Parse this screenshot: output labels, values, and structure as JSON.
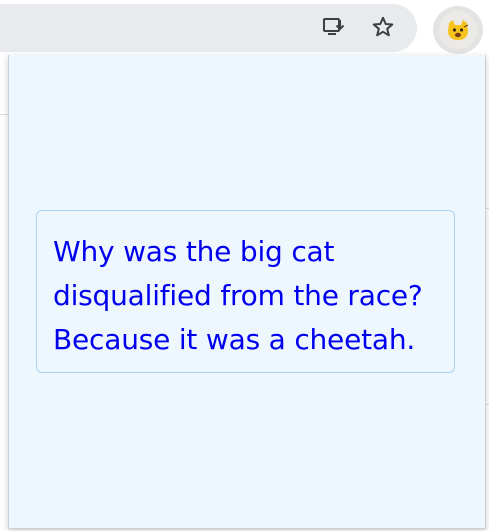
{
  "toolbar": {
    "install_icon": "install-app-icon",
    "bookmark_icon": "star-icon",
    "extension_icon": "cat-emoji-icon"
  },
  "popup": {
    "joke_lines": [
      "Why was the big cat",
      "disqualified from the race?",
      "Because it was a cheetah."
    ]
  },
  "colors": {
    "popup_background": "#eef7fe",
    "joke_text": "#0000ee",
    "joke_border": "#aad2ee",
    "toolbar_background": "#e8eaed"
  }
}
